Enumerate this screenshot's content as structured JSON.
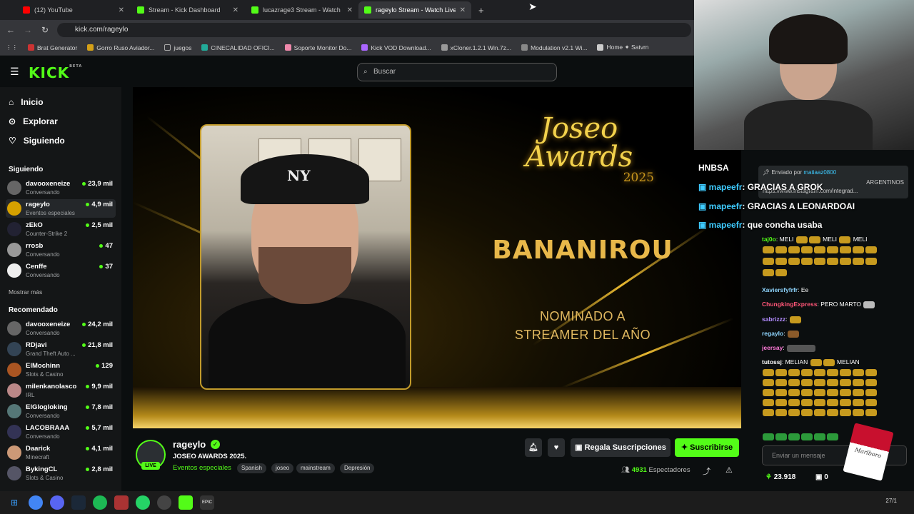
{
  "browser": {
    "tabs": [
      {
        "title": "(12) YouTube",
        "color": "#ff0000",
        "active": false
      },
      {
        "title": "Stream - Kick Dashboard",
        "color": "#53fc18",
        "active": false
      },
      {
        "title": "lucazrage3 Stream - Watch Live",
        "color": "#53fc18",
        "active": false
      },
      {
        "title": "rageylo Stream - Watch Live",
        "color": "#53fc18",
        "active": true
      }
    ],
    "new_tab": "+",
    "url": "kick.com/rageylo",
    "bookmarks": [
      "Brat Generator",
      "Gorro Ruso Aviador...",
      "juegos",
      "CINECALIDAD OFICI...",
      "Soporte Monitor Do...",
      "Kick VOD Download...",
      "xCloner.1.2.1 Win.7z...",
      "Modulation v2.1 Wi...",
      "Home ✦ Satvrn"
    ]
  },
  "kick": {
    "logo": "KICK",
    "logo_beta": "BETA",
    "search_placeholder": "Buscar",
    "nav": [
      {
        "label": "Inicio",
        "icon": "⌂"
      },
      {
        "label": "Explorar",
        "icon": "⊙"
      },
      {
        "label": "Siguiendo",
        "icon": "♡"
      }
    ],
    "following_title": "Siguiendo",
    "following": [
      {
        "name": "davooxeneize",
        "category": "Conversando",
        "viewers": "23,9 mil"
      },
      {
        "name": "rageylo",
        "category": "Eventos especiales",
        "viewers": "4,9 mil"
      },
      {
        "name": "zEkO",
        "category": "Counter-Strike 2",
        "viewers": "2,5 mil"
      },
      {
        "name": "rrosb",
        "category": "Conversando",
        "viewers": "47"
      },
      {
        "name": "Cenffe",
        "category": "Conversando",
        "viewers": "37"
      }
    ],
    "show_more": "Mostrar más",
    "recommended_title": "Recomendado",
    "recommended": [
      {
        "name": "davooxeneize",
        "category": "Conversando",
        "viewers": "24,2 mil"
      },
      {
        "name": "RDjavi",
        "category": "Grand Theft Auto ...",
        "viewers": "21,8 mil"
      },
      {
        "name": "ElMochinn",
        "category": "Slots & Casino",
        "viewers": "129"
      },
      {
        "name": "milenkanolasco",
        "category": "IRL",
        "viewers": "9,9 mil"
      },
      {
        "name": "ElGlogloking",
        "category": "Conversando",
        "viewers": "7,8 mil"
      },
      {
        "name": "LACOBRAAA",
        "category": "Conversando",
        "viewers": "5,7 mil"
      },
      {
        "name": "Daarick",
        "category": "Minecraft",
        "viewers": "4,1 mil"
      },
      {
        "name": "BykingCL",
        "category": "Slots & Casino",
        "viewers": "2,8 mil"
      }
    ]
  },
  "video": {
    "award_line1": "Joseo",
    "award_line2": "Awards",
    "award_year": "2025",
    "nominee": "BANANIROU",
    "category_line1": "NOMINADO A",
    "category_line2": "STREAMER DEL AÑO",
    "cap_logo": "NY"
  },
  "stream": {
    "username": "rageylo",
    "live": "LIVE",
    "title": "JOSEO AWARDS 2025.",
    "category": "Eventos especiales",
    "tags": [
      "Spanish",
      "joseo",
      "mainstream",
      "Depresión"
    ],
    "gift_label": "Regala Suscripciones",
    "subscribe_label": "Suscribirse",
    "viewers_count": "4931",
    "viewers_label": "Espectadores"
  },
  "overlay_chat": [
    {
      "user": "",
      "text": "HNBSA"
    },
    {
      "user": "mapeefr",
      "text": ": GRACIAS A GROK"
    },
    {
      "user": "mapeefr",
      "text": ": GRACIAS A LEONARDOAI"
    },
    {
      "user": "mapeefr",
      "text": ": que concha usaba"
    }
  ],
  "pinned": {
    "sent_by": "Enviado por",
    "sender": "matiaaz0800",
    "text": "ARGENTINOS",
    "link": "https://www.instagram.com/integrad..."
  },
  "chat": [
    {
      "user": "taj0o",
      "color": "#53fc18",
      "text": ": MELI"
    },
    {
      "user": "Xaviersfyfrfr",
      "color": "#8fd6ff",
      "text": ": Ee"
    },
    {
      "user": "ChungkingExpress",
      "color": "#ff5577",
      "text": ": PERO MARTO"
    },
    {
      "user": "sabrizzz",
      "color": "#b38cff",
      "text": ":"
    },
    {
      "user": "regaylo",
      "color": "#8fd6ff",
      "text": ":"
    },
    {
      "user": "jeersay",
      "color": "#ff7ad9",
      "text": ":"
    },
    {
      "user": "tutossj",
      "color": "#ffffff",
      "text": ": MELIAN"
    }
  ],
  "chat_input_placeholder": "Enviar un mensaje",
  "points": "23.918",
  "gifts": "0",
  "pack_label": "Marlboro",
  "clock": "27/1"
}
